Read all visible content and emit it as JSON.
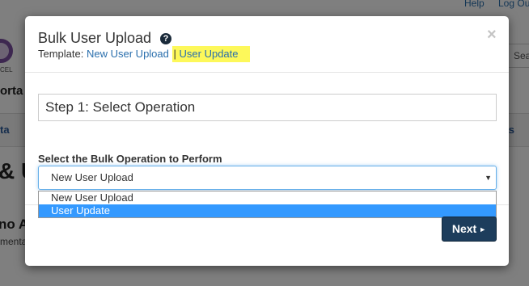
{
  "background": {
    "topnav": {
      "help": "Help",
      "logout": "Log Ou"
    },
    "logo_text": "CEL",
    "portal_fragment": "orta",
    "search_fragment": "Sear",
    "tab_left_fragment": "ta",
    "tab_right_fragment": "s",
    "heading_fragment": "& U",
    "subheading_fragment": "no A",
    "subtext_fragment": "menta"
  },
  "modal": {
    "title": "Bulk User Upload",
    "help_icon": "?",
    "close": "×",
    "template_label": "Template:",
    "template_links": [
      "New User Upload",
      "User Update"
    ],
    "template_separator": "|",
    "step_title": "Step 1: Select Operation",
    "select_label": "Select the Bulk Operation to Perform",
    "select_value": "New User Upload",
    "select_caret": "▼",
    "options": [
      {
        "label": "New User Upload",
        "selected": false
      },
      {
        "label": "User Update",
        "selected": true
      }
    ],
    "next_button": "Next",
    "next_caret": "►"
  },
  "colors": {
    "primary_button": "#1d3d5c",
    "link": "#2a6fad",
    "highlight": "#fdf85a",
    "option_selected": "#3399ff"
  }
}
